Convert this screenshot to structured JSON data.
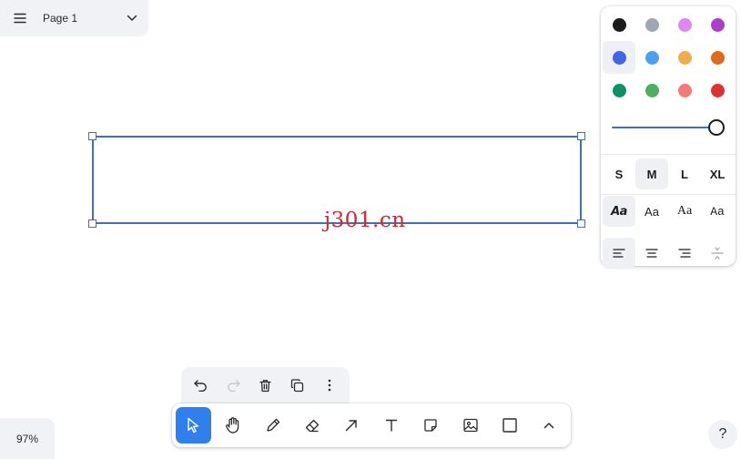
{
  "page_menu": {
    "page_name": "Page 1",
    "menu_icon": "hamburger-icon",
    "chevron_icon": "chevron-down-icon"
  },
  "watermark": "j301.cn",
  "style_panel": {
    "colors": [
      {
        "name": "black",
        "hex": "#1d1d1d"
      },
      {
        "name": "grey",
        "hex": "#9fa8b2"
      },
      {
        "name": "light-violet",
        "hex": "#e085f4"
      },
      {
        "name": "violet",
        "hex": "#ae3ec9"
      },
      {
        "name": "blue",
        "hex": "#4465e9",
        "selected": true
      },
      {
        "name": "light-blue",
        "hex": "#4ba1f1"
      },
      {
        "name": "yellow",
        "hex": "#f1ac4b"
      },
      {
        "name": "orange",
        "hex": "#e16919"
      },
      {
        "name": "green",
        "hex": "#099268"
      },
      {
        "name": "light-green",
        "hex": "#4cb05e"
      },
      {
        "name": "light-red",
        "hex": "#f87777"
      },
      {
        "name": "red",
        "hex": "#e03131"
      }
    ],
    "opacity_value": 1,
    "sizes": [
      "S",
      "M",
      "L",
      "XL"
    ],
    "selected_size": "M",
    "fonts": [
      "Aa",
      "Aa",
      "Aa",
      "Aa"
    ],
    "alignments": [
      "align-left-icon",
      "align-center-icon",
      "align-right-icon",
      "vertical-align-icon"
    ]
  },
  "quick_actions": [
    "undo-icon",
    "redo-icon",
    "trash-icon",
    "duplicate-icon",
    "more-vertical-icon"
  ],
  "toolbar": [
    "select-icon",
    "hand-icon",
    "pencil-icon",
    "eraser-icon",
    "arrow-icon",
    "text-icon",
    "note-icon",
    "image-icon",
    "rectangle-icon",
    "chevron-up-icon"
  ],
  "zoom": "97%",
  "help": "?",
  "accent_color": "#2f80ed",
  "selection_color": "#3d71b8"
}
